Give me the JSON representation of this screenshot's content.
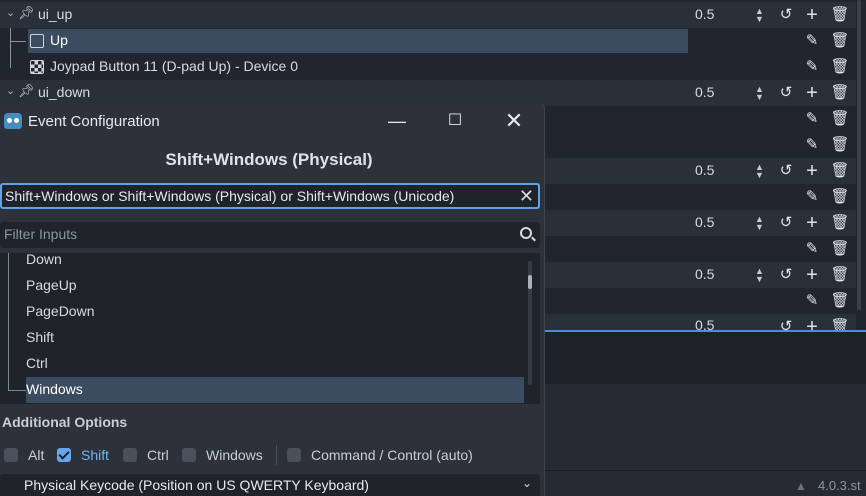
{
  "actions": [
    {
      "name": "ui_up",
      "deadzone": "0.5"
    },
    {
      "name": "ui_down",
      "deadzone": "0.5"
    }
  ],
  "events": [
    {
      "label": "Up"
    },
    {
      "label": "Joypad Button 11 (D-pad Up) - Device 0"
    }
  ],
  "extra_deadzones": [
    "0.5",
    "0.5",
    "0.5",
    "0.5"
  ],
  "dialog": {
    "title": "Event Configuration",
    "heading": "Shift+Windows (Physical)",
    "listen_text": "Shift+Windows or Shift+Windows (Physical) or Shift+Windows (Unicode)",
    "filter_placeholder": "Filter Inputs",
    "tree_items": [
      "Down",
      "PageUp",
      "PageDown",
      "Shift",
      "Ctrl",
      "Windows"
    ],
    "additional_options_label": "Additional Options",
    "options": [
      {
        "label": "Alt",
        "checked": false
      },
      {
        "label": "Shift",
        "checked": true
      },
      {
        "label": "Ctrl",
        "checked": false
      },
      {
        "label": "Windows",
        "checked": false
      },
      {
        "label": "Command / Control (auto)",
        "checked": false
      }
    ],
    "keycode_mode": "Physical Keycode (Position on US QWERTY Keyboard)"
  },
  "status": {
    "version": "4.0.3.st"
  },
  "icons": {
    "revert": "revert-icon",
    "add": "add-icon",
    "remove": "trash-icon",
    "edit": "edit-icon",
    "close": "close-icon",
    "minimize": "minimize-icon",
    "maximize": "maximize-icon",
    "search": "search-icon"
  },
  "colors": {
    "accent": "#5fa3e8",
    "selection": "#3b4b60",
    "background": "#21262e"
  }
}
